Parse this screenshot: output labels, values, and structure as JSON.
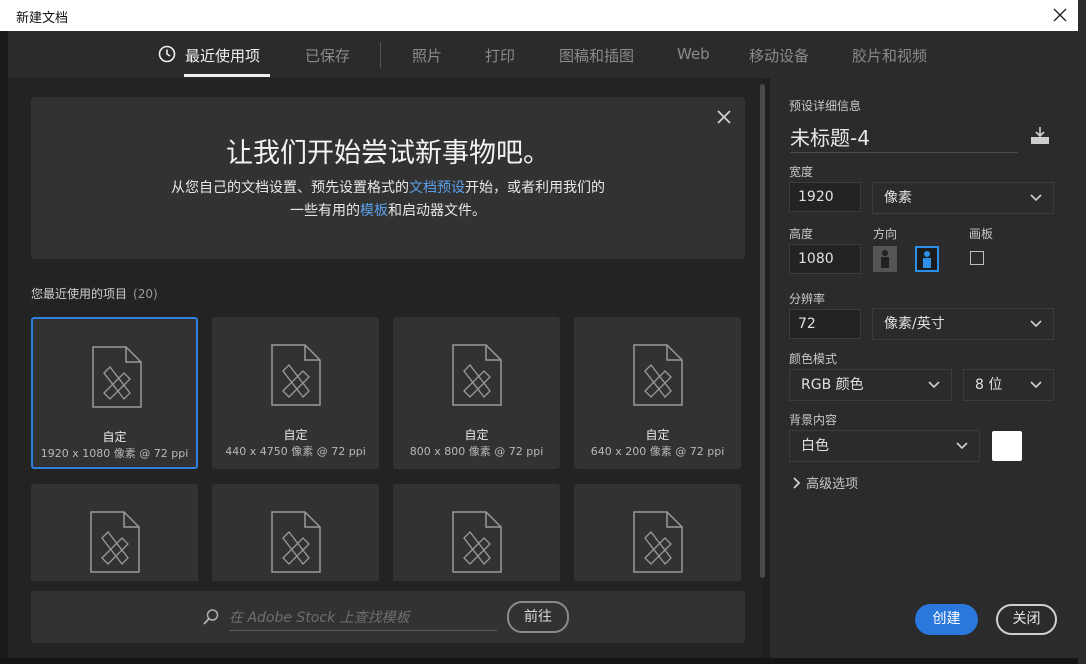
{
  "window": {
    "title": "新建文档"
  },
  "tabs": [
    {
      "label": "最近使用项"
    },
    {
      "label": "已保存"
    },
    {
      "label": "照片"
    },
    {
      "label": "打印"
    },
    {
      "label": "图稿和插图"
    },
    {
      "label": "Web"
    },
    {
      "label": "移动设备"
    },
    {
      "label": "胶片和视频"
    }
  ],
  "hero": {
    "title": "让我们开始尝试新事物吧。",
    "line1_a": "从您自己的文档设置、预先设置格式的",
    "line1_link": "文档预设",
    "line1_b": "开始，或者利用我们的",
    "line2_a": "一些有用的",
    "line2_link": "模板",
    "line2_b": "和启动器文件。"
  },
  "recent": {
    "label": "您最近使用的项目",
    "count": "(20)"
  },
  "presets": [
    {
      "name": "自定",
      "dims": "1920 x 1080 像素 @ 72 ppi",
      "selected": true
    },
    {
      "name": "自定",
      "dims": "440 x 4750 像素 @ 72 ppi",
      "selected": false
    },
    {
      "name": "自定",
      "dims": "800 x 800 像素 @ 72 ppi",
      "selected": false
    },
    {
      "name": "自定",
      "dims": "640 x 200 像素 @ 72 ppi",
      "selected": false
    }
  ],
  "stock": {
    "placeholder": "在 Adobe Stock 上查找模板",
    "go_label": "前往"
  },
  "details": {
    "header": "预设详细信息",
    "doc_name": "未标题-4",
    "width_label": "宽度",
    "width_value": "1920",
    "width_unit": "像素",
    "height_label": "高度",
    "height_value": "1080",
    "orientation_label": "方向",
    "artboard_label": "画板",
    "resolution_label": "分辨率",
    "resolution_value": "72",
    "resolution_unit": "像素/英寸",
    "color_mode_label": "颜色模式",
    "color_mode": "RGB 颜色",
    "bit_depth": "8 位",
    "background_label": "背景内容",
    "background": "白色",
    "advanced_label": "高级选项"
  },
  "buttons": {
    "create": "创建",
    "close": "关闭"
  },
  "colors": {
    "accent": "#2a78dc",
    "panel": "#2b2b2b",
    "card": "#323232"
  }
}
